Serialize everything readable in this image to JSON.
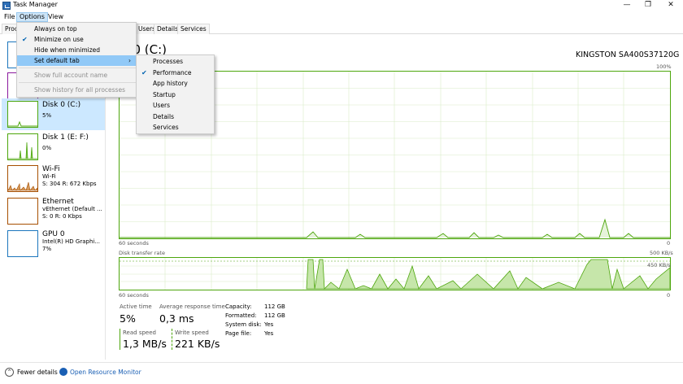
{
  "window": {
    "title": "Task Manager",
    "minimize": "—",
    "maximize": "❐",
    "close": "✕"
  },
  "menubar": {
    "file": "File",
    "options": "Options",
    "view": "View"
  },
  "tabs": {
    "processes_partial": "Proc",
    "users_partial": "Users",
    "details": "Details",
    "services": "Services"
  },
  "options_menu": {
    "items": [
      {
        "label": "Always on top",
        "checked": false,
        "disabled": false
      },
      {
        "label": "Minimize on use",
        "checked": true,
        "disabled": false
      },
      {
        "label": "Hide when minimized",
        "checked": false,
        "disabled": false
      },
      {
        "label": "Set default tab",
        "checked": false,
        "disabled": false,
        "submenu": true
      },
      {
        "label": "Show full account name",
        "checked": false,
        "disabled": true
      },
      {
        "label": "Show history for all processes",
        "checked": false,
        "disabled": true
      }
    ]
  },
  "default_tab_menu": {
    "items": [
      "Processes",
      "Performance",
      "App history",
      "Startup",
      "Users",
      "Details",
      "Services"
    ],
    "checked_index": 1
  },
  "sidebar": {
    "items": [
      {
        "name": "Disk 0 (C:)",
        "sub": "5%"
      },
      {
        "name": "Disk 1 (E: F:)",
        "sub": "0%"
      },
      {
        "name": "Wi-Fi",
        "sub": "Wi-Fi",
        "sub2": "S: 304  R: 672 Kbps"
      },
      {
        "name": "Ethernet",
        "sub": "vEthernet (Default ...",
        "sub2": "S: 0  R: 0 Kbps"
      },
      {
        "name": "GPU 0",
        "sub": "Intel(R) HD Graphi...",
        "sub2": "7%"
      }
    ]
  },
  "main": {
    "title": "k 0 (C:)",
    "model": "KINGSTON SA400S37120G",
    "graph1": {
      "top_right": "100%",
      "bottom_left": "60 seconds",
      "bottom_right": "0"
    },
    "graph2": {
      "label": "Disk transfer rate",
      "top_right": "500 KB/s",
      "line_label": "450 KB/s",
      "bottom_left": "60 seconds",
      "bottom_right": "0"
    },
    "stats": {
      "active_time_label": "Active time",
      "active_time": "5%",
      "avg_resp_label": "Average response time",
      "avg_resp": "0,3 ms",
      "read_label": "Read speed",
      "read": "1,3 MB/s",
      "write_label": "Write speed",
      "write": "221 KB/s"
    },
    "props": [
      {
        "key": "Capacity:",
        "value": "112 GB"
      },
      {
        "key": "Formatted:",
        "value": "112 GB"
      },
      {
        "key": "System disk:",
        "value": "Yes"
      },
      {
        "key": "Page file:",
        "value": "Yes"
      }
    ]
  },
  "bottom": {
    "fewer_details": "Fewer details",
    "resource_monitor": "Open Resource Monitor"
  },
  "colors": {
    "disk": "#4da60c",
    "net": "#a74f01",
    "gpu": "#1c76bd",
    "selection": "#cce8ff",
    "menu_highlight": "#91c9f7"
  }
}
